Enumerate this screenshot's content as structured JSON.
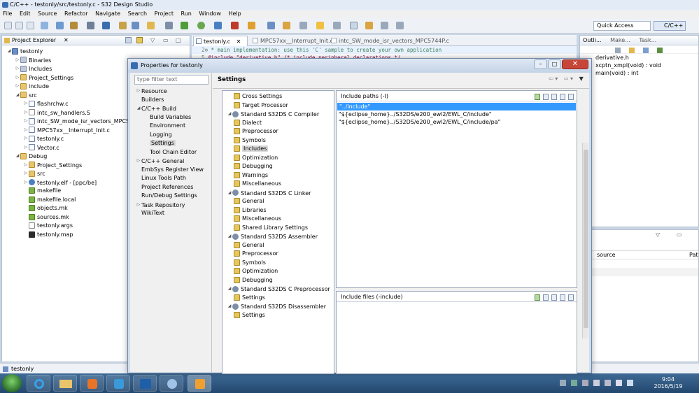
{
  "window": {
    "title": "C/C++ - testonly/src/testonly.c - S32 Design Studio"
  },
  "menu": [
    "File",
    "Edit",
    "Source",
    "Refactor",
    "Navigate",
    "Search",
    "Project",
    "Run",
    "Window",
    "Help"
  ],
  "toolbar": {
    "quick_access": "Quick Access",
    "perspective": "C/C++"
  },
  "project_explorer": {
    "title": "Project Explorer",
    "items": [
      {
        "label": "testonly",
        "icon": "project-icon",
        "depth": 0,
        "twisty": "open"
      },
      {
        "label": "Binaries",
        "icon": "binaries-icon",
        "depth": 1,
        "twisty": "closed"
      },
      {
        "label": "Includes",
        "icon": "includes-icon",
        "depth": 1,
        "twisty": "closed"
      },
      {
        "label": "Project_Settings",
        "icon": "folder-icon",
        "depth": 1,
        "twisty": "closed"
      },
      {
        "label": "include",
        "icon": "folder-icon",
        "depth": 1,
        "twisty": "closed"
      },
      {
        "label": "src",
        "icon": "folder-icon",
        "depth": 1,
        "twisty": "open"
      },
      {
        "label": "flashrchw.c",
        "icon": "c-file-icon",
        "depth": 2,
        "twisty": "closed"
      },
      {
        "label": "intc_sw_handlers.S",
        "icon": "s-file-icon",
        "depth": 2,
        "twisty": "closed"
      },
      {
        "label": "intc_SW_mode_isr_vectors_MPC5744P.c",
        "icon": "c-file-icon",
        "depth": 2,
        "twisty": "closed"
      },
      {
        "label": "MPC57xx__Interrupt_Init.c",
        "icon": "c-file-icon",
        "depth": 2,
        "twisty": "closed"
      },
      {
        "label": "testonly.c",
        "icon": "c-file-icon",
        "depth": 2,
        "twisty": "closed"
      },
      {
        "label": "Vector.c",
        "icon": "c-file-icon",
        "depth": 2,
        "twisty": "closed"
      },
      {
        "label": "Debug",
        "icon": "folder-icon",
        "depth": 1,
        "twisty": "open"
      },
      {
        "label": "Project_Settings",
        "icon": "folder-icon",
        "depth": 2,
        "twisty": "closed"
      },
      {
        "label": "src",
        "icon": "folder-icon",
        "depth": 2,
        "twisty": "closed"
      },
      {
        "label": "testonly.elf - [ppc/be]",
        "icon": "elf-icon",
        "depth": 2,
        "twisty": "closed"
      },
      {
        "label": "makefile",
        "icon": "makefile-icon",
        "depth": 2,
        "twisty": "none"
      },
      {
        "label": "makefile.local",
        "icon": "makefile-icon",
        "depth": 2,
        "twisty": "none"
      },
      {
        "label": "objects.mk",
        "icon": "makefile-icon",
        "depth": 2,
        "twisty": "none"
      },
      {
        "label": "sources.mk",
        "icon": "makefile-icon",
        "depth": 2,
        "twisty": "none"
      },
      {
        "label": "testonly.args",
        "icon": "file-icon",
        "depth": 2,
        "twisty": "none"
      },
      {
        "label": "testonly.map",
        "icon": "map-file-icon",
        "depth": 2,
        "twisty": "none"
      }
    ]
  },
  "editor": {
    "tabs": [
      "testonly.c",
      "MPC57xx__Interrupt_Init.c",
      "intc_SW_mode_isr_vectors_MPC5744P.c"
    ],
    "lines": [
      {
        "num": "2⊕",
        "text": " * main implementation: use this 'C' sample to create your own application"
      },
      {
        "num": "5",
        "text": "#include \"derivative.h\" /* include peripheral declarations */"
      }
    ]
  },
  "outline": {
    "tabs": [
      "Outli...",
      "Make...",
      "Task..."
    ],
    "items": [
      "derivative.h",
      "xcptn_xmpl(void) : void",
      "main(void) : int"
    ]
  },
  "lower_panel": {
    "columns": [
      "source",
      "Pat"
    ]
  },
  "status": {
    "text": "testonly"
  },
  "dialog": {
    "title": "Properties for testonly",
    "filter_placeholder": "type filter text",
    "page_title": "Settings",
    "nav": [
      {
        "label": "Resource",
        "depth": 0,
        "twisty": "closed"
      },
      {
        "label": "Builders",
        "depth": 0,
        "twisty": "none"
      },
      {
        "label": "C/C++ Build",
        "depth": 0,
        "twisty": "open"
      },
      {
        "label": "Build Variables",
        "depth": 1,
        "twisty": "none"
      },
      {
        "label": "Environment",
        "depth": 1,
        "twisty": "none"
      },
      {
        "label": "Logging",
        "depth": 1,
        "twisty": "none"
      },
      {
        "label": "Settings",
        "depth": 1,
        "twisty": "none",
        "selected": true
      },
      {
        "label": "Tool Chain Editor",
        "depth": 1,
        "twisty": "none"
      },
      {
        "label": "C/C++ General",
        "depth": 0,
        "twisty": "closed"
      },
      {
        "label": "EmbSys Register View",
        "depth": 0,
        "twisty": "none"
      },
      {
        "label": "Linux Tools Path",
        "depth": 0,
        "twisty": "none"
      },
      {
        "label": "Project References",
        "depth": 0,
        "twisty": "none"
      },
      {
        "label": "Run/Debug Settings",
        "depth": 0,
        "twisty": "none"
      },
      {
        "label": "Task Repository",
        "depth": 0,
        "twisty": "closed"
      },
      {
        "label": "WikiText",
        "depth": 0,
        "twisty": "none"
      }
    ],
    "tool_settings": [
      {
        "label": "Cross Settings",
        "depth": 1,
        "twisty": "none",
        "kind": "leaf"
      },
      {
        "label": "Target Processor",
        "depth": 1,
        "twisty": "none",
        "kind": "leaf"
      },
      {
        "label": "Standard S32DS C Compiler",
        "depth": 0,
        "twisty": "open",
        "kind": "tool"
      },
      {
        "label": "Dialect",
        "depth": 1,
        "twisty": "none",
        "kind": "leaf"
      },
      {
        "label": "Preprocessor",
        "depth": 1,
        "twisty": "none",
        "kind": "leaf"
      },
      {
        "label": "Symbols",
        "depth": 1,
        "twisty": "none",
        "kind": "leaf"
      },
      {
        "label": "Includes",
        "depth": 1,
        "twisty": "none",
        "kind": "leaf",
        "selected": true
      },
      {
        "label": "Optimization",
        "depth": 1,
        "twisty": "none",
        "kind": "leaf"
      },
      {
        "label": "Debugging",
        "depth": 1,
        "twisty": "none",
        "kind": "leaf"
      },
      {
        "label": "Warnings",
        "depth": 1,
        "twisty": "none",
        "kind": "leaf"
      },
      {
        "label": "Miscellaneous",
        "depth": 1,
        "twisty": "none",
        "kind": "leaf"
      },
      {
        "label": "Standard S32DS C Linker",
        "depth": 0,
        "twisty": "open",
        "kind": "tool"
      },
      {
        "label": "General",
        "depth": 1,
        "twisty": "none",
        "kind": "leaf"
      },
      {
        "label": "Libraries",
        "depth": 1,
        "twisty": "none",
        "kind": "leaf"
      },
      {
        "label": "Miscellaneous",
        "depth": 1,
        "twisty": "none",
        "kind": "leaf"
      },
      {
        "label": "Shared Library Settings",
        "depth": 1,
        "twisty": "none",
        "kind": "leaf"
      },
      {
        "label": "Standard S32DS Assembler",
        "depth": 0,
        "twisty": "open",
        "kind": "tool"
      },
      {
        "label": "General",
        "depth": 1,
        "twisty": "none",
        "kind": "leaf"
      },
      {
        "label": "Preprocessor",
        "depth": 1,
        "twisty": "none",
        "kind": "leaf"
      },
      {
        "label": "Symbols",
        "depth": 1,
        "twisty": "none",
        "kind": "leaf"
      },
      {
        "label": "Optimization",
        "depth": 1,
        "twisty": "none",
        "kind": "leaf"
      },
      {
        "label": "Debugging",
        "depth": 1,
        "twisty": "none",
        "kind": "leaf"
      },
      {
        "label": "Standard S32DS C Preprocessor",
        "depth": 0,
        "twisty": "open",
        "kind": "tool"
      },
      {
        "label": "Settings",
        "depth": 1,
        "twisty": "none",
        "kind": "leaf"
      },
      {
        "label": "Standard S32DS Disassembler",
        "depth": 0,
        "twisty": "open",
        "kind": "tool"
      },
      {
        "label": "Settings",
        "depth": 1,
        "twisty": "none",
        "kind": "leaf"
      }
    ],
    "include_paths": {
      "title": "Include paths (-I)",
      "items": [
        "\"../include\"",
        "\"${eclipse_home}../S32DS/e200_ewl2/EWL_C/include\"",
        "\"${eclipse_home}../S32DS/e200_ewl2/EWL_C/include/pa\""
      ]
    },
    "include_files": {
      "title": "Include files (-include)",
      "items": []
    }
  },
  "taskbar": {
    "time": "9:04",
    "date": "2016/5/19"
  },
  "colors": {
    "selection": "#3399ff",
    "accent": "#2a5d9f"
  }
}
